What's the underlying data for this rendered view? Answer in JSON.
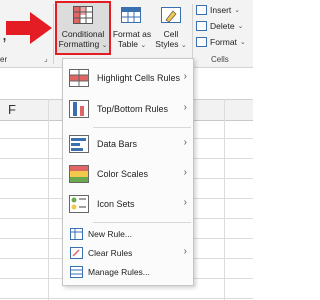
{
  "ribbon": {
    "left_glyph": ",",
    "left_group_label": "er",
    "styles_group": {
      "conditional_formatting": {
        "line1": "Conditional",
        "line2": "Formatting",
        "chevron": "⌄"
      },
      "format_as_table": {
        "line1": "Format as",
        "line2": "Table",
        "chevron": "⌄"
      },
      "cell_styles": {
        "line1": "Cell",
        "line2": "Styles",
        "chevron": "⌄"
      }
    },
    "cells_group": {
      "insert": {
        "label": "Insert",
        "chevron": "⌄"
      },
      "delete": {
        "label": "Delete",
        "chevron": "⌄"
      },
      "format": {
        "label": "Format",
        "chevron": "⌄"
      },
      "label": "Cells"
    },
    "launcher_glyph": "⌟"
  },
  "sheet": {
    "column_label": "F"
  },
  "menu": {
    "items": [
      {
        "label": "Highlight Cells Rules",
        "submenu": "›"
      },
      {
        "label": "Top/Bottom Rules",
        "submenu": "›"
      },
      {
        "label": "Data Bars",
        "submenu": "›"
      },
      {
        "label": "Color Scales",
        "submenu": "›"
      },
      {
        "label": "Icon Sets",
        "submenu": "›"
      }
    ],
    "actions": [
      {
        "label": "New Rule..."
      },
      {
        "label": "Clear Rules",
        "submenu": "›"
      },
      {
        "label": "Manage Rules..."
      }
    ]
  },
  "colors": {
    "highlight_border": "#e31d23",
    "arrow": "#e31d23",
    "accent_blue": "#3a6fb0"
  }
}
